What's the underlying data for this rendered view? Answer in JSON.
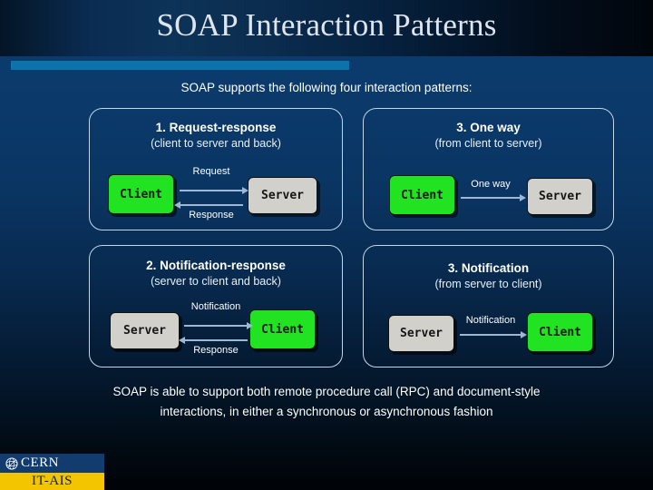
{
  "slide": {
    "title": "SOAP Interaction Patterns",
    "intro_text": "SOAP supports the following four interaction patterns:",
    "outro_line1": "SOAP is able to support both remote procedure call (RPC) and document-style",
    "outro_line2": "interactions, in either a synchronous or asynchronous fashion"
  },
  "colors": {
    "accent_bar": "#0d73ad",
    "panel_border": "#c3d6e8",
    "client_node": "#22e322",
    "server_node": "#d2d0cb",
    "arrow": "#9db8d4",
    "logo_blue": "#123c6e",
    "logo_yellow": "#f2c500",
    "background_top": "#0b3c6e",
    "background_bottom": "#000307"
  },
  "patterns": [
    {
      "title": "1. Request-response",
      "subtitle": "(client to server and back)",
      "left_node": "Client",
      "right_node": "Server",
      "top_arrow_label": "Request",
      "bottom_arrow_label": "Response"
    },
    {
      "title": "3. One way",
      "subtitle": "(from client to server)",
      "left_node": "Client",
      "right_node": "Server",
      "arrow_label": "One way"
    },
    {
      "title": "2. Notification-response",
      "subtitle": "(server to client and back)",
      "left_node": "Server",
      "right_node": "Client",
      "top_arrow_label": "Notification",
      "bottom_arrow_label": "Response"
    },
    {
      "title": "3. Notification",
      "subtitle": "(from server to client)",
      "left_node": "Server",
      "right_node": "Client",
      "arrow_label": "Notification"
    }
  ],
  "logo": {
    "org": "CERN",
    "group": "IT-AIS"
  }
}
